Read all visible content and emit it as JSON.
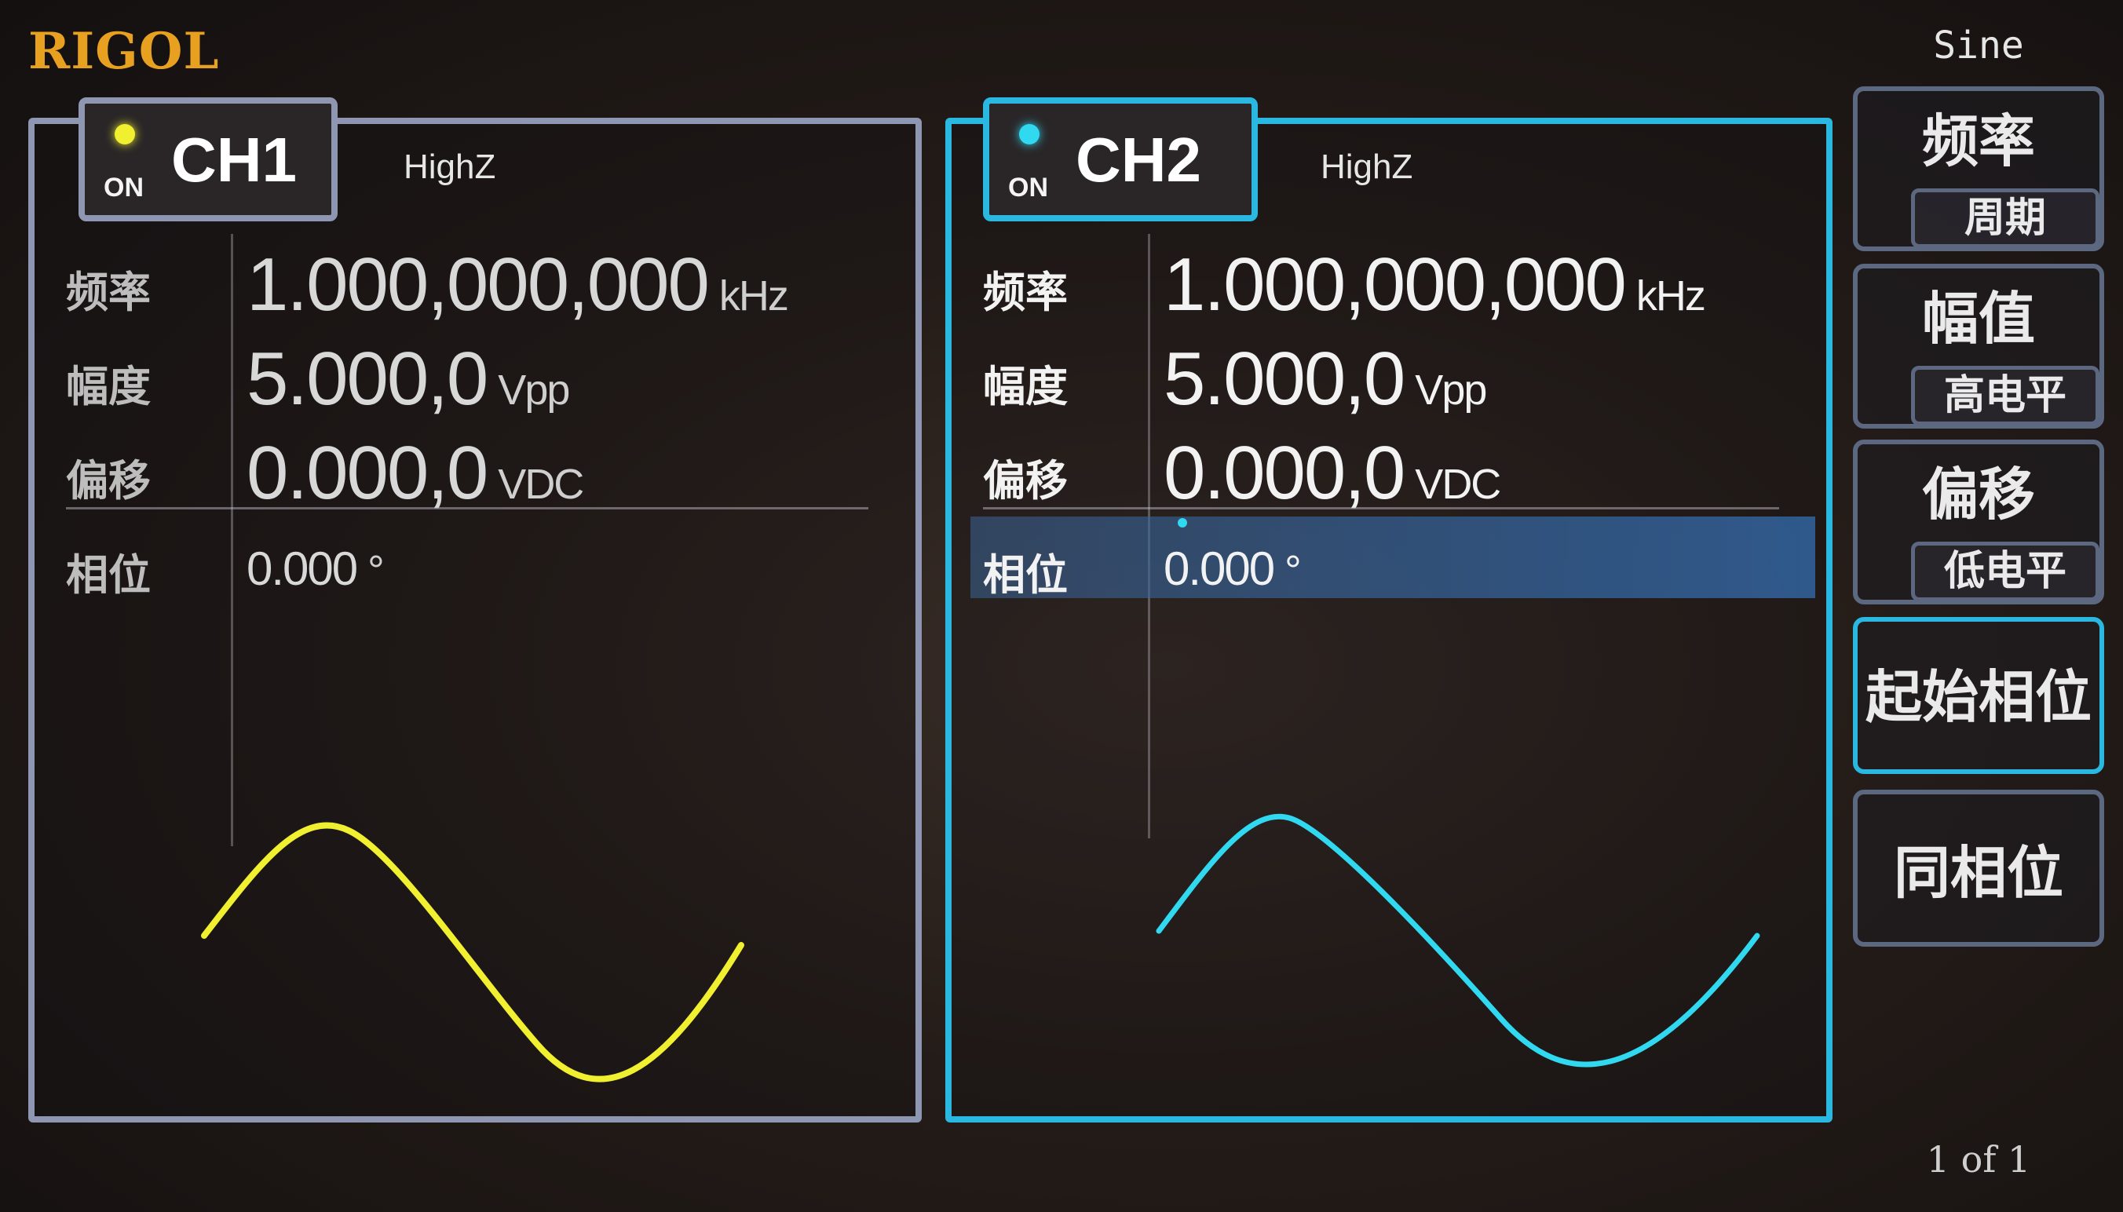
{
  "brand": "RIGOL",
  "waveform_type": "Sine",
  "page_indicator": "1 of 1",
  "channels": [
    {
      "name": "CH1",
      "state": "ON",
      "impedance": "HighZ",
      "color": "#f0f030",
      "params": [
        {
          "label": "频率",
          "value": "1.000,000,000",
          "unit": "kHz"
        },
        {
          "label": "幅度",
          "value": "5.000,0",
          "unit": "Vpp"
        },
        {
          "label": "偏移",
          "value": "0.000,0",
          "unit": "VDC"
        },
        {
          "label": "相位",
          "value": "0.000",
          "unit": "°"
        }
      ]
    },
    {
      "name": "CH2",
      "state": "ON",
      "impedance": "HighZ",
      "color": "#30d8f0",
      "params": [
        {
          "label": "频率",
          "value": "1.000,000,000",
          "unit": "kHz"
        },
        {
          "label": "幅度",
          "value": "5.000,0",
          "unit": "Vpp"
        },
        {
          "label": "偏移",
          "value": "0.000,0",
          "unit": "VDC"
        },
        {
          "label": "相位",
          "value": "0.000",
          "unit": "°"
        }
      ]
    }
  ],
  "softkeys": [
    {
      "label": "频率",
      "sub_label": "周期"
    },
    {
      "label": "幅值",
      "sub_label": "高电平"
    },
    {
      "label": "偏移",
      "sub_label": "低电平"
    },
    {
      "label": "起始相位"
    },
    {
      "label": "同相位"
    }
  ],
  "colors": {
    "ch1_border": "#8f96b2",
    "ch2_border": "#2ab8e0",
    "brand": "#e8a020",
    "selection": "#3264a0"
  }
}
